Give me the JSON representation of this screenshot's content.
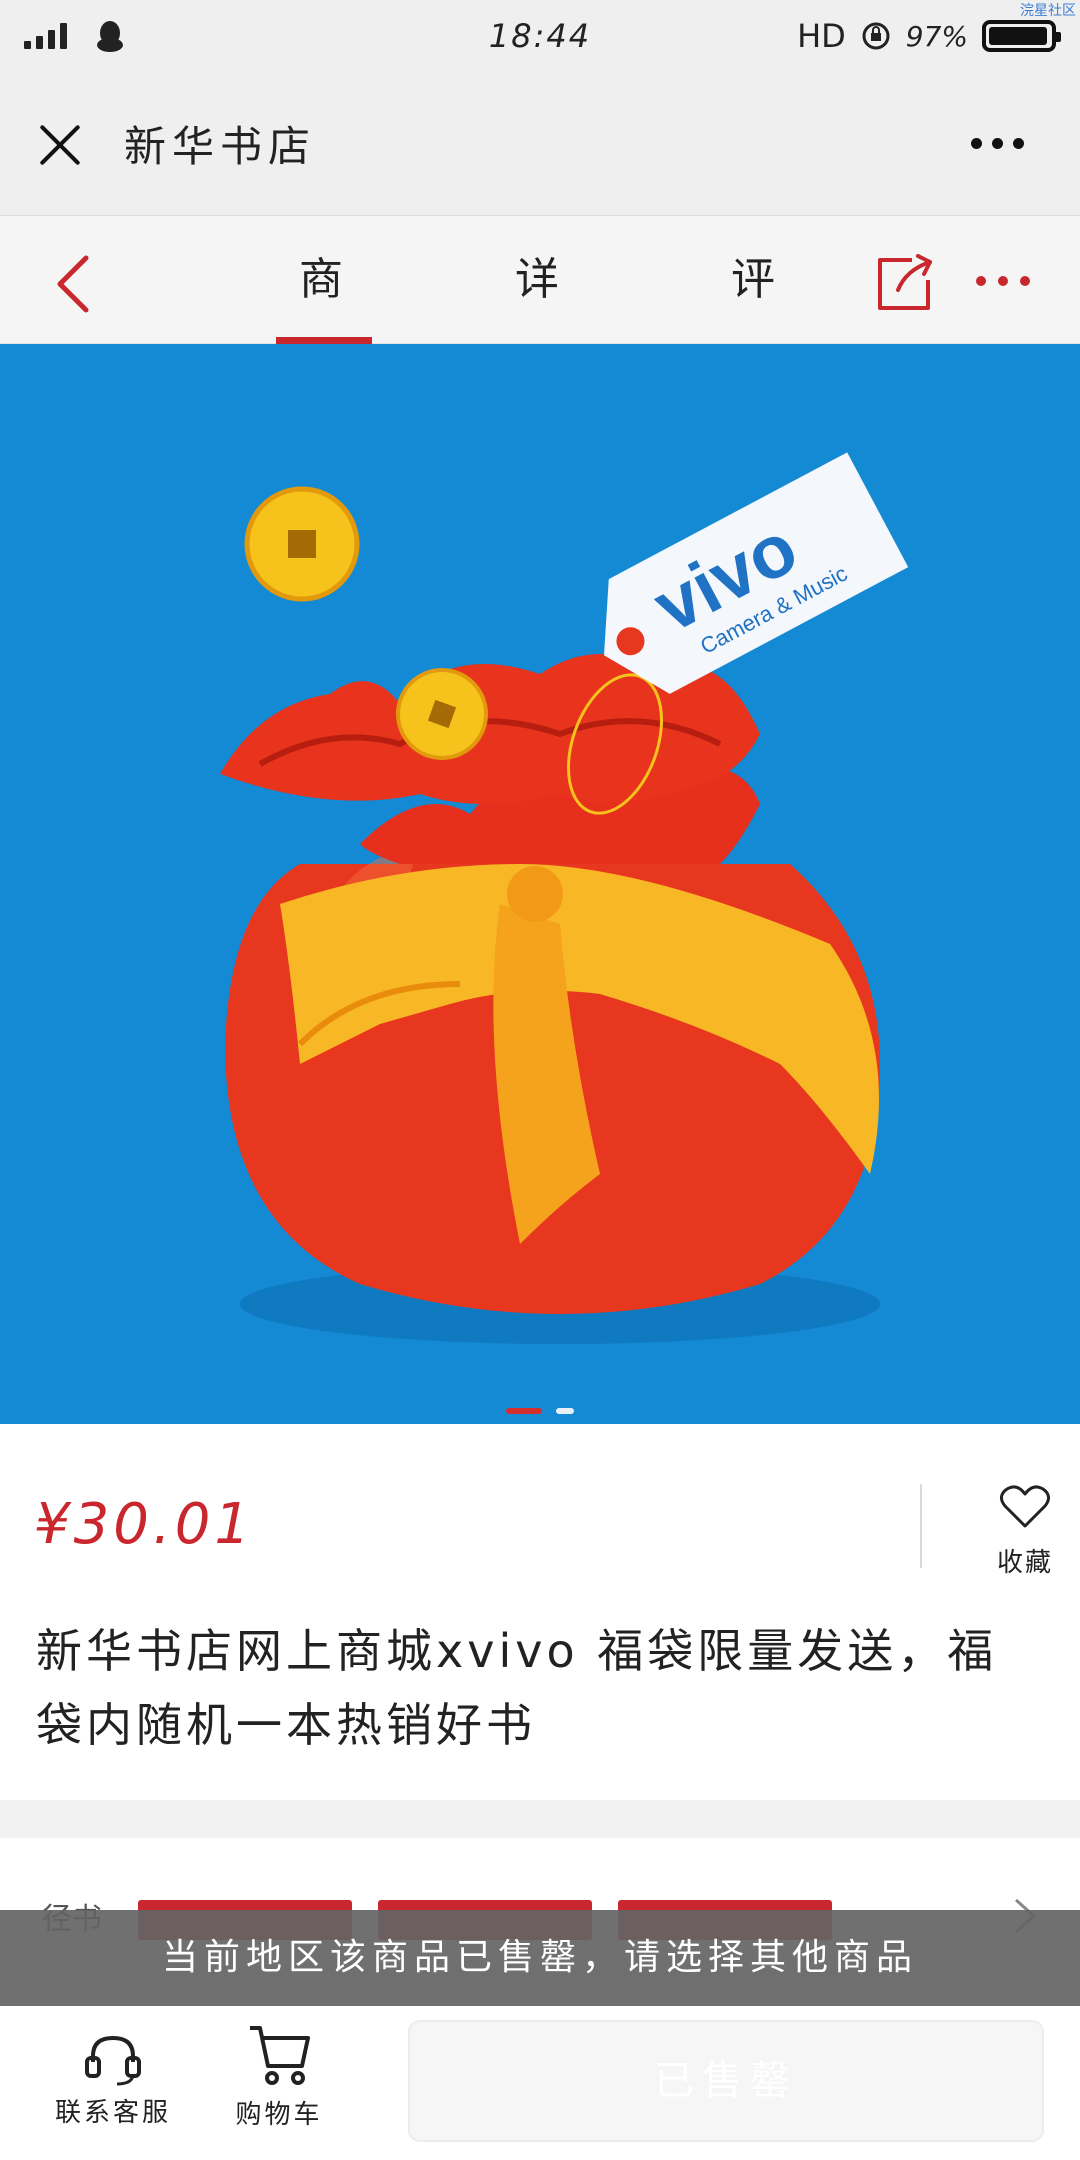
{
  "status_bar": {
    "time": "18:44",
    "network": "HD",
    "battery": "97%",
    "battery_level": 0.97,
    "watermark": "浣星社区"
  },
  "title_bar": {
    "title": "新华书店"
  },
  "nav": {
    "tabs": [
      {
        "label": "商品",
        "active": true
      },
      {
        "label": "详情",
        "active": false
      },
      {
        "label": "评价",
        "active": false
      }
    ]
  },
  "product_image": {
    "tag_brand": "vivo",
    "tag_slogan": "Camera & Music",
    "slide_count": 2,
    "current_slide": 1
  },
  "product": {
    "price": "¥30.01",
    "favorite_label": "收藏",
    "title": "新华书店网上商城xvivo 福袋限量发送，福袋内随机一本热销好书"
  },
  "specs": {
    "label": "径书"
  },
  "banner": {
    "message": "当前地区该商品已售罄，请选择其他商品"
  },
  "bottom_bar": {
    "service_label": "联系客服",
    "cart_label": "购物车",
    "action_label": "已售罄"
  },
  "colors": {
    "accent": "#c8282d",
    "image_background": "#1489d4"
  }
}
